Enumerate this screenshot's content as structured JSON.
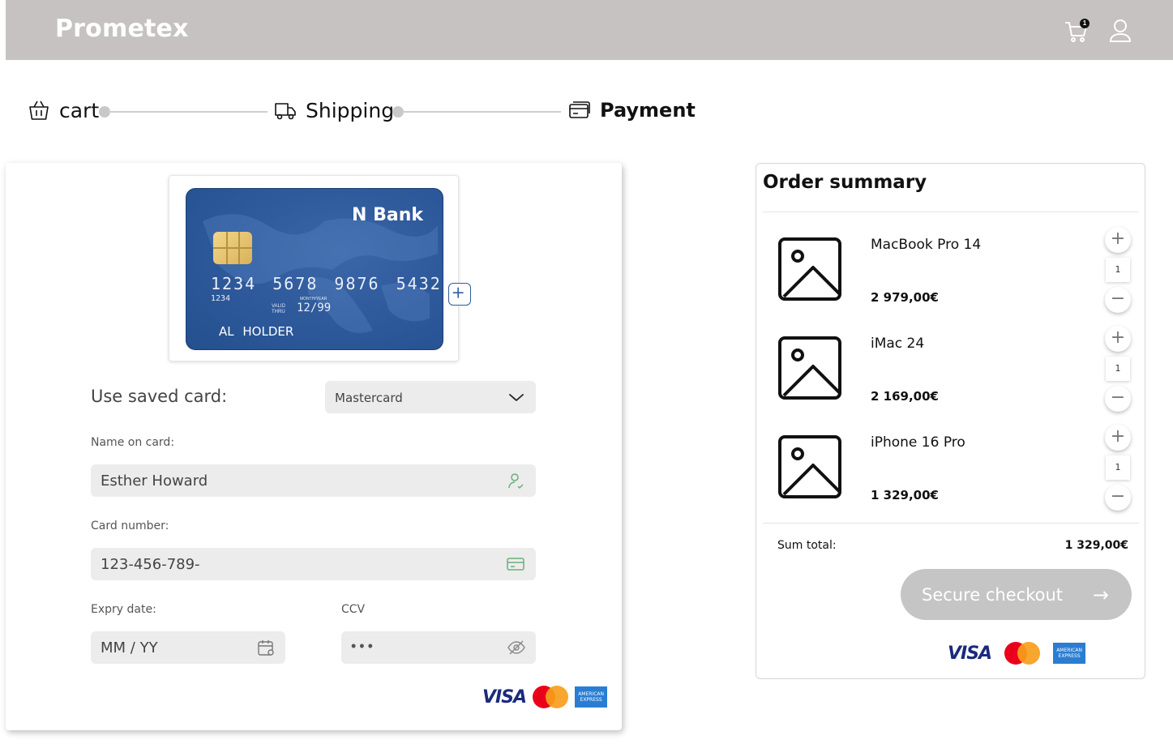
{
  "header": {
    "brand": "Prometex",
    "cart_badge": "1",
    "icons": [
      "cart-icon",
      "user-icon"
    ]
  },
  "stepper": {
    "steps": [
      {
        "label": "cart",
        "icon": "basket-icon",
        "active": false
      },
      {
        "label": "Shipping",
        "icon": "truck-icon",
        "active": false
      },
      {
        "label": "Payment",
        "icon": "credit-card-icon",
        "active": true
      }
    ]
  },
  "card_preview": {
    "bank_name": "N Bank",
    "number": "1234 5678 9876 5432",
    "small_number": "1234",
    "valid_label": "VALID THRU",
    "month_year_label": "MONTH/YEAR",
    "expiry": "12/99",
    "holder": "AL HOLDER"
  },
  "form": {
    "saved_card_label": "Use saved card:",
    "saved_card_value": "Mastercard",
    "name_label": "Name on card:",
    "name_value": "Esther Howard",
    "card_number_label": "Card number:",
    "card_number_value": "123-456-789-",
    "expiry_label": "Expry date:",
    "expiry_placeholder": "MM / YY",
    "ccv_label": "CCV",
    "ccv_value": "•••"
  },
  "payment_logos": {
    "visa": "VISA",
    "amex": "AMERICAN EXPRESS"
  },
  "summary": {
    "title": "Order summary",
    "items": [
      {
        "name": "MacBook Pro 14",
        "price": "2 979,00€",
        "qty": "1"
      },
      {
        "name": "iMac 24",
        "price": "2 169,00€",
        "qty": "1"
      },
      {
        "name": "iPhone 16 Pro",
        "price": "1 329,00€",
        "qty": "1"
      }
    ],
    "sum_label": "Sum total:",
    "sum_value": "1 329,00€",
    "checkout_label": "Secure checkout",
    "checkout_arrow": "→"
  },
  "colors": {
    "header_bg": "#c5c2c1",
    "card_blue": "#2f5a9c",
    "field_bg": "#ececec",
    "checkout_disabled": "#c5c5c5"
  }
}
